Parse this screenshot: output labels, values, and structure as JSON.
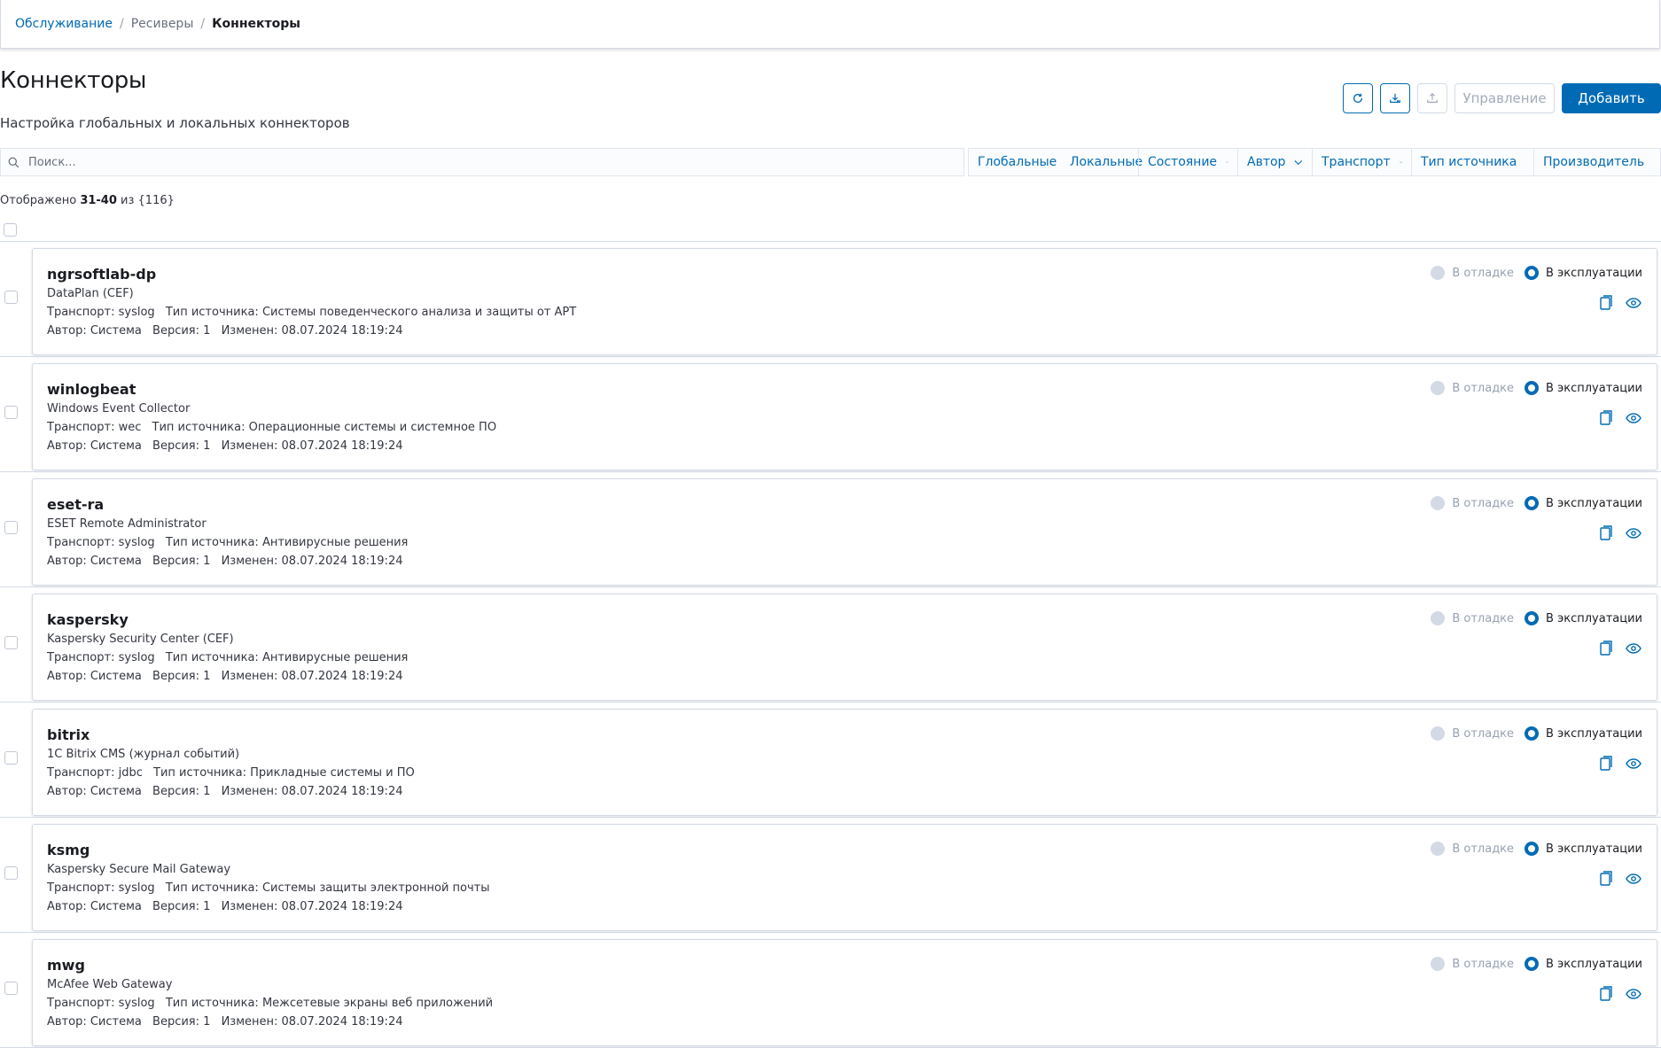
{
  "breadcrumb": {
    "items": [
      "Обслуживание",
      "Ресиверы",
      "Коннекторы"
    ],
    "separator": "/"
  },
  "page": {
    "title": "Коннекторы",
    "description": "Настройка глобальных и локальных коннекторов"
  },
  "header_actions": {
    "refresh_icon": "refresh-icon",
    "import_icon": "import-icon",
    "export_icon": "export-icon",
    "manage_label": "Управление",
    "add_label": "Добавить"
  },
  "search": {
    "placeholder": "Поиск..."
  },
  "filters": [
    "Глобальные",
    "Локальные",
    "Состояние",
    "Автор",
    "Транспорт",
    "Тип источника",
    "Производитель"
  ],
  "count": {
    "prefix": "Отображено",
    "range": "31-40",
    "suffix": "из {116}"
  },
  "labels": {
    "transport": "Транспорт:",
    "source_type": "Тип источника:",
    "author": "Автор:",
    "version": "Версия:",
    "modified": "Изменен:",
    "debug": "В отладке",
    "production": "В эксплуатации"
  },
  "colors": {
    "accent": "#006bb4",
    "border": "#d3dae6",
    "disabled_radio": "#d3dae6"
  },
  "connectors": [
    {
      "name": "ngrsoftlab-dp",
      "product": "DataPlan (CEF)",
      "transport": "syslog",
      "source_type": "Системы поведенческого анализа и защиты от APT",
      "author": "Система",
      "version": "1",
      "modified": "08.07.2024 18:19:24",
      "state": "production"
    },
    {
      "name": "winlogbeat",
      "product": "Windows Event Collector",
      "transport": "wec",
      "source_type": "Операционные системы и системное ПО",
      "author": "Система",
      "version": "1",
      "modified": "08.07.2024 18:19:24",
      "state": "production"
    },
    {
      "name": "eset-ra",
      "product": "ESET Remote Administrator",
      "transport": "syslog",
      "source_type": "Антивирусные решения",
      "author": "Система",
      "version": "1",
      "modified": "08.07.2024 18:19:24",
      "state": "production"
    },
    {
      "name": "kaspersky",
      "product": "Kaspersky Security Center (CEF)",
      "transport": "syslog",
      "source_type": "Антивирусные решения",
      "author": "Система",
      "version": "1",
      "modified": "08.07.2024 18:19:24",
      "state": "production"
    },
    {
      "name": "bitrix",
      "product": "1C Bitrix CMS (журнал событий)",
      "transport": "jdbc",
      "source_type": "Прикладные системы и ПО",
      "author": "Система",
      "version": "1",
      "modified": "08.07.2024 18:19:24",
      "state": "production"
    },
    {
      "name": "ksmg",
      "product": "Kaspersky Secure Mail Gateway",
      "transport": "syslog",
      "source_type": "Системы защиты электронной почты",
      "author": "Система",
      "version": "1",
      "modified": "08.07.2024 18:19:24",
      "state": "production"
    },
    {
      "name": "mwg",
      "product": "McAfee Web Gateway",
      "transport": "syslog",
      "source_type": "Межсетевые экраны веб приложений",
      "author": "Система",
      "version": "1",
      "modified": "08.07.2024 18:19:24",
      "state": "production"
    }
  ]
}
